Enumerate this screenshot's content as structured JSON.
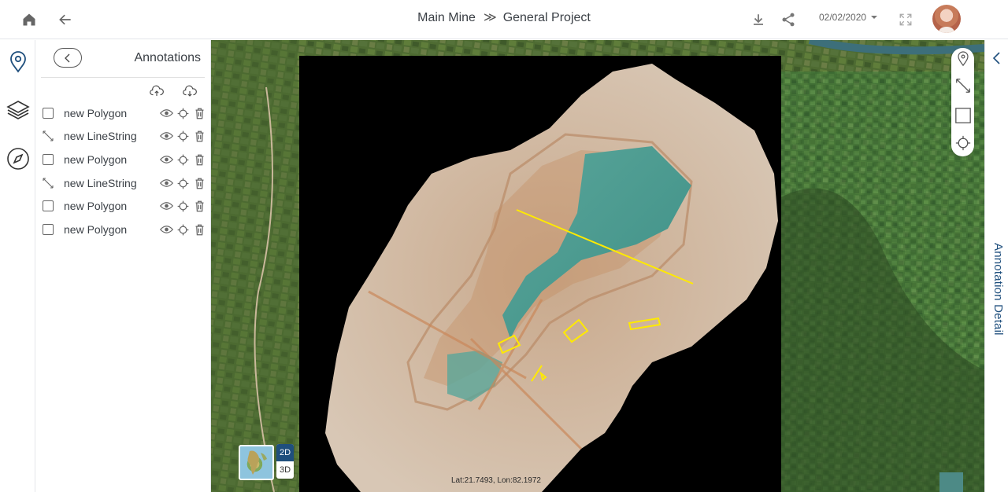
{
  "header": {
    "project": "Main Mine",
    "separator": "≫",
    "subproject": "General Project",
    "date": "02/02/2020"
  },
  "icons": {
    "home": "home-icon",
    "back": "arrow-left-icon",
    "download": "download-icon",
    "share": "share-icon",
    "fullscreen": "fullscreen-icon",
    "location": "map-pin-icon",
    "layers": "layers-icon",
    "compass": "compass-icon"
  },
  "panel": {
    "title": "Annotations",
    "items": [
      {
        "type": "polygon",
        "label": "new Polygon"
      },
      {
        "type": "linestring",
        "label": "new LineString"
      },
      {
        "type": "polygon",
        "label": "new Polygon"
      },
      {
        "type": "linestring",
        "label": "new LineString"
      },
      {
        "type": "polygon",
        "label": "new Polygon"
      },
      {
        "type": "polygon",
        "label": "new Polygon"
      }
    ]
  },
  "map": {
    "coordinates": "Lat:21.7493, Lon:82.1972",
    "view_2d": "2D",
    "view_3d": "3D",
    "annotation_color": "#ffea00",
    "imagery_background": "#000000"
  },
  "detail": {
    "label": "Annotation Detail"
  },
  "colors": {
    "accent": "#1f4f7d",
    "text": "#3a3f45"
  }
}
